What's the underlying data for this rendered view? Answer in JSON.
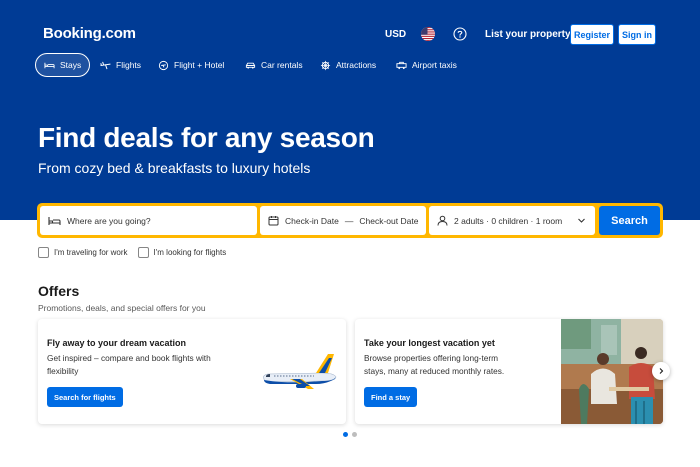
{
  "brand": {
    "logo": "Booking.com"
  },
  "header": {
    "currency": "USD",
    "flag_icon": "us-flag-icon",
    "help_icon": "help-icon",
    "list_property": "List your property",
    "register": "Register",
    "sign_in": "Sign in"
  },
  "nav": {
    "items": [
      {
        "label": "Stays",
        "icon": "bed-icon",
        "active": true
      },
      {
        "label": "Flights",
        "icon": "plane-icon",
        "active": false
      },
      {
        "label": "Flight + Hotel",
        "icon": "flight-hotel-icon",
        "active": false
      },
      {
        "label": "Car rentals",
        "icon": "car-icon",
        "active": false
      },
      {
        "label": "Attractions",
        "icon": "attractions-icon",
        "active": false
      },
      {
        "label": "Airport taxis",
        "icon": "taxi-icon",
        "active": false
      }
    ]
  },
  "hero": {
    "title": "Find deals for any season",
    "subtitle": "From cozy bed & breakfasts to luxury hotels"
  },
  "search": {
    "destination_placeholder": "Where are you going?",
    "check_in": "Check-in Date",
    "dash": "—",
    "check_out": "Check-out Date",
    "guests": "2 adults · 0 children · 1 room",
    "button": "Search"
  },
  "checkboxes": {
    "work": "I'm traveling for work",
    "flights": "I'm looking for flights"
  },
  "offers": {
    "title": "Offers",
    "subtitle": "Promotions, deals, and special offers for you",
    "cards": [
      {
        "title": "Fly away to your dream vacation",
        "text": "Get inspired – compare and book flights with flexibility",
        "button": "Search for flights"
      },
      {
        "title": "Take your longest vacation yet",
        "text": "Browse properties offering long-term stays, many at reduced monthly rates.",
        "button": "Find a stay"
      }
    ]
  },
  "colors": {
    "brand_blue": "#003b95",
    "action_blue": "#006ce4",
    "search_border": "#ffb700"
  }
}
